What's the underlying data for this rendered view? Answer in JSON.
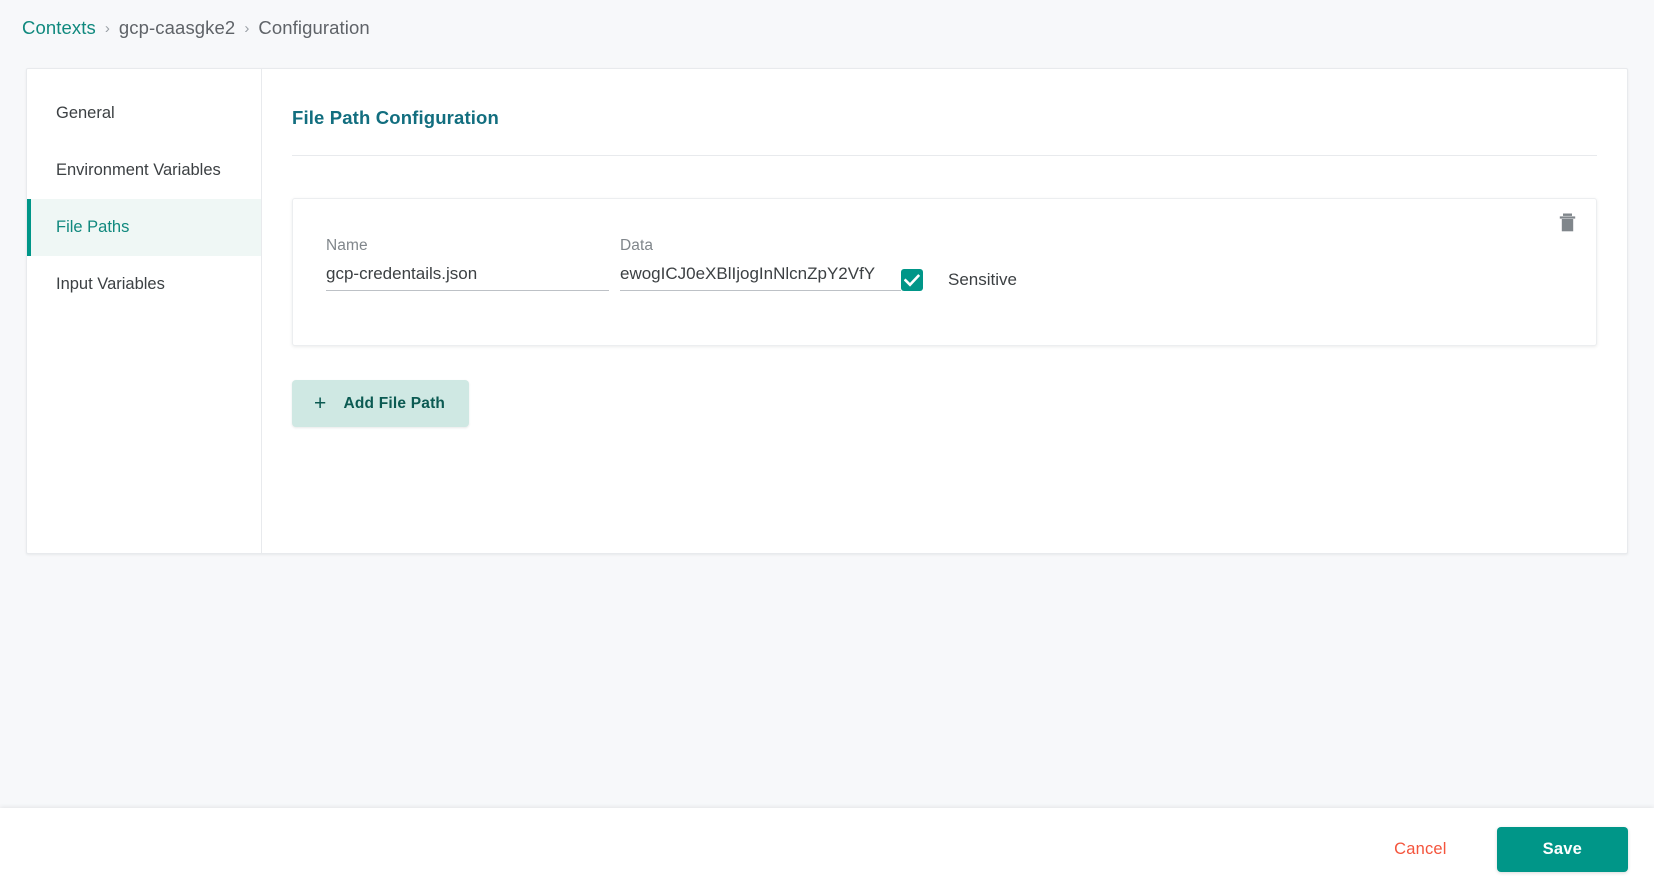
{
  "breadcrumb": {
    "root": "Contexts",
    "separator": "›",
    "context": "gcp-caasgke2",
    "current": "Configuration"
  },
  "sidebar": {
    "items": [
      {
        "label": "General",
        "active": false
      },
      {
        "label": "Environment Variables",
        "active": false
      },
      {
        "label": "File Paths",
        "active": true
      },
      {
        "label": "Input Variables",
        "active": false
      }
    ]
  },
  "main": {
    "title": "File Path Configuration",
    "file_paths": [
      {
        "name_label": "Name",
        "name_value": "gcp-credentails.json",
        "name_placeholder": "Name",
        "data_label": "Data",
        "data_value": "ewogICJ0eXBlIjogInNlcnZpY2VfY",
        "data_placeholder": "Data",
        "sensitive_label": "Sensitive",
        "sensitive_checked": true,
        "delete_icon": "trash-icon"
      }
    ],
    "add_button": {
      "icon": "plus-icon",
      "plus": "+",
      "label": "Add File Path"
    }
  },
  "footer": {
    "cancel_label": "Cancel",
    "save_label": "Save"
  },
  "colors": {
    "accent_teal": "#009688",
    "link_teal": "#10897e",
    "title_teal": "#126e7f",
    "add_button_bg": "#cfe8e3",
    "cancel_red": "#f4543c",
    "page_bg": "#f7f8fa",
    "active_item_bg": "#eff7f5"
  }
}
